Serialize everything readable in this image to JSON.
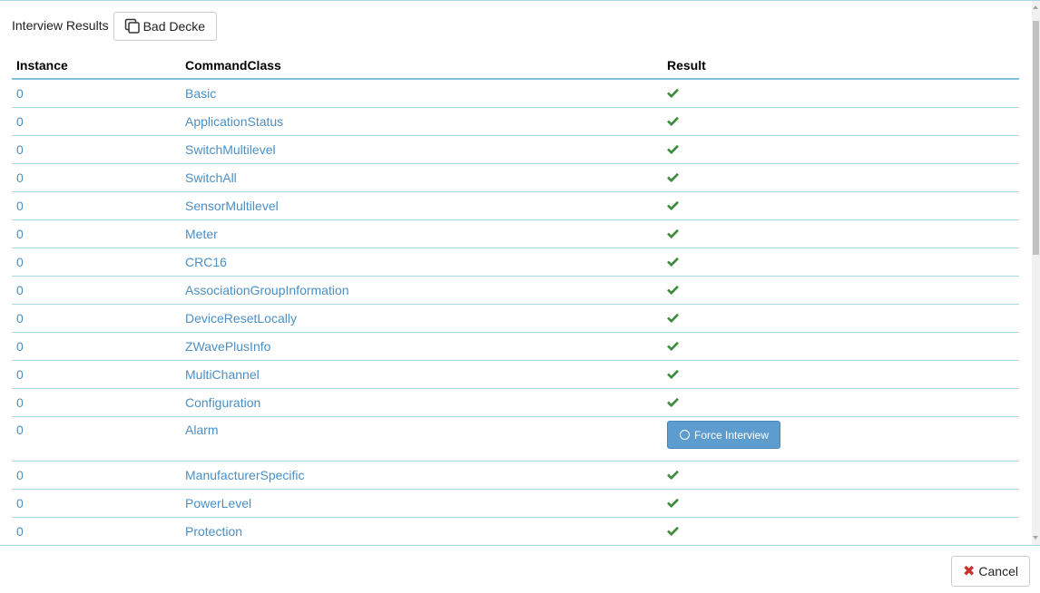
{
  "header": {
    "title": "Interview Results",
    "copy_button_label": "Bad Decke"
  },
  "table": {
    "columns": [
      "Instance",
      "CommandClass",
      "Result"
    ],
    "rows": [
      {
        "instance": "0",
        "command_class": "Basic",
        "result": "ok"
      },
      {
        "instance": "0",
        "command_class": "ApplicationStatus",
        "result": "ok"
      },
      {
        "instance": "0",
        "command_class": "SwitchMultilevel",
        "result": "ok"
      },
      {
        "instance": "0",
        "command_class": "SwitchAll",
        "result": "ok"
      },
      {
        "instance": "0",
        "command_class": "SensorMultilevel",
        "result": "ok"
      },
      {
        "instance": "0",
        "command_class": "Meter",
        "result": "ok"
      },
      {
        "instance": "0",
        "command_class": "CRC16",
        "result": "ok"
      },
      {
        "instance": "0",
        "command_class": "AssociationGroupInformation",
        "result": "ok"
      },
      {
        "instance": "0",
        "command_class": "DeviceResetLocally",
        "result": "ok"
      },
      {
        "instance": "0",
        "command_class": "ZWavePlusInfo",
        "result": "ok"
      },
      {
        "instance": "0",
        "command_class": "MultiChannel",
        "result": "ok"
      },
      {
        "instance": "0",
        "command_class": "Configuration",
        "result": "ok"
      },
      {
        "instance": "0",
        "command_class": "Alarm",
        "result": "force",
        "button_label": "Force Interview"
      },
      {
        "instance": "0",
        "command_class": "ManufacturerSpecific",
        "result": "ok"
      },
      {
        "instance": "0",
        "command_class": "PowerLevel",
        "result": "ok"
      },
      {
        "instance": "0",
        "command_class": "Protection",
        "result": "ok"
      }
    ]
  },
  "footer": {
    "cancel_label": "Cancel"
  },
  "icons": {
    "copy": "copy-icon",
    "check": "check-icon",
    "refresh": "circle-icon",
    "cancel": "close-icon"
  },
  "colors": {
    "link": "#4a8fc6",
    "check": "#3c8a3c",
    "primary_button": "#5d9ccf",
    "cancel_icon": "#c9302c",
    "row_border": "#a9d6e5"
  }
}
